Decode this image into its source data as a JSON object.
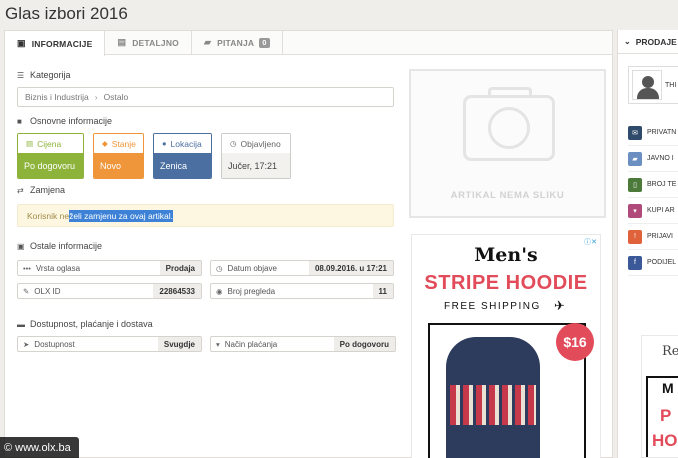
{
  "page": {
    "title": "Glas izbori 2016"
  },
  "tabs": [
    {
      "label": "INFORMACIJE",
      "icon": "info-icon"
    },
    {
      "label": "DETALJNO",
      "icon": "document-icon"
    },
    {
      "label": "PITANJA",
      "icon": "chat-icon",
      "count": "0"
    }
  ],
  "sections": {
    "category": "Kategorija",
    "basic": "Osnovne informacije",
    "exchange": "Zamjena",
    "other": "Ostale informacije",
    "availability": "Dostupnost, plaćanje i dostava"
  },
  "breadcrumb": [
    "Biznis i Industrija",
    "Ostalo"
  ],
  "basic_cards": [
    {
      "label": "Cijena",
      "value": "Po dogovoru",
      "color": "#8db33a"
    },
    {
      "label": "Stanje",
      "value": "Novo",
      "color": "#f0963a"
    },
    {
      "label": "Lokacija",
      "value": "Zenica",
      "color": "#4a6fa0"
    },
    {
      "label": "Objavljeno",
      "value": "Jučer, 17:21",
      "color": "#f2f1ee"
    }
  ],
  "exchange_notice": {
    "prefix": "Korisnik ne ",
    "highlight": "želi zamjenu za ovaj artikal."
  },
  "other_info": [
    {
      "label": "Vrsta oglasa",
      "value": "Prodaja"
    },
    {
      "label": "Datum objave",
      "value": "08.09.2016. u 17:21"
    },
    {
      "label": "OLX ID",
      "value": "22864533"
    },
    {
      "label": "Broj pregleda",
      "value": "11"
    }
  ],
  "availability": [
    {
      "label": "Dostupnost",
      "value": "Svugdje"
    },
    {
      "label": "Način plaćanja",
      "value": "Po dogovoru"
    }
  ],
  "no_image": "ARTIKAL NEMA SLIKU",
  "ad": {
    "line1": "Men's",
    "line2": "STRIPE HOODIE",
    "line3": "FREE SHIPPING",
    "price": "$16"
  },
  "right_panel": {
    "header": "PRODAJE",
    "seller_name": "THI",
    "actions": [
      {
        "label": "PRIVATN",
        "color": "#2f4a6a"
      },
      {
        "label": "JAVNO I",
        "color": "#6a8fc0"
      },
      {
        "label": "BROJ TE",
        "color": "#4b7a3a"
      },
      {
        "label": "KUPI AR",
        "color": "#b04a7a"
      },
      {
        "label": "PRIJAVI",
        "color": "#e0623a"
      },
      {
        "label": "PODIJEL",
        "color": "#3b5998"
      }
    ],
    "ad_text": [
      "Re",
      "M",
      "P",
      "HO"
    ]
  },
  "watermark": "© www.olx.ba"
}
